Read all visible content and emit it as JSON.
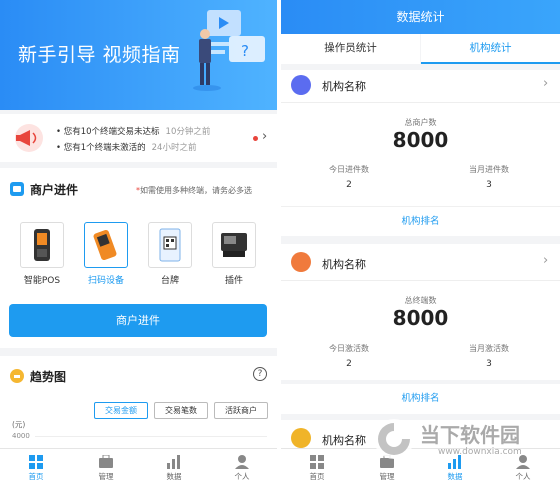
{
  "left": {
    "banner": {
      "title": "新手引导 视频指南"
    },
    "notices": [
      {
        "text": "您有10个终端交易未达标",
        "time": "10分钟之前"
      },
      {
        "text": "您有1个终端未激活的",
        "time": "24小时之前"
      }
    ],
    "merchant": {
      "title": "商户进件",
      "note_star": "*",
      "note": "如需使用多种终端，请务必多选",
      "devices": [
        {
          "label": "智能POS"
        },
        {
          "label": "扫码设备"
        },
        {
          "label": "台牌"
        },
        {
          "label": "插件"
        }
      ],
      "button": "商户进件"
    },
    "trend": {
      "title": "趋势图",
      "help": "?",
      "chips": [
        "交易金额",
        "交易笔数",
        "活跃商户"
      ],
      "unit": "(元)",
      "first_tick": "4000"
    },
    "tabs": [
      "首页",
      "管理",
      "数据",
      "个人"
    ]
  },
  "right": {
    "header": "数据统计",
    "segments": [
      "操作员统计",
      "机构统计"
    ],
    "orgs": [
      {
        "name": "机构名称",
        "total_label": "总商户数",
        "total": "8000",
        "left_label": "今日进件数",
        "left_value": "2",
        "right_label": "当月进件数",
        "right_value": "3",
        "rank": "机构排名",
        "icon_color": "#5b6cf0"
      },
      {
        "name": "机构名称",
        "total_label": "总终端数",
        "total": "8000",
        "left_label": "今日激活数",
        "left_value": "2",
        "right_label": "当月激活数",
        "right_value": "3",
        "rank": "机构排名",
        "icon_color": "#f07a3c"
      },
      {
        "name": "机构名称",
        "icon_color": "#f0b429"
      }
    ],
    "tabs": [
      "首页",
      "管理",
      "数据",
      "个人"
    ]
  },
  "watermark": {
    "text": "当下软件园",
    "url": "www.downxia.com"
  },
  "colors": {
    "accent": "#1e9bf0",
    "alert": "#e8453c"
  }
}
